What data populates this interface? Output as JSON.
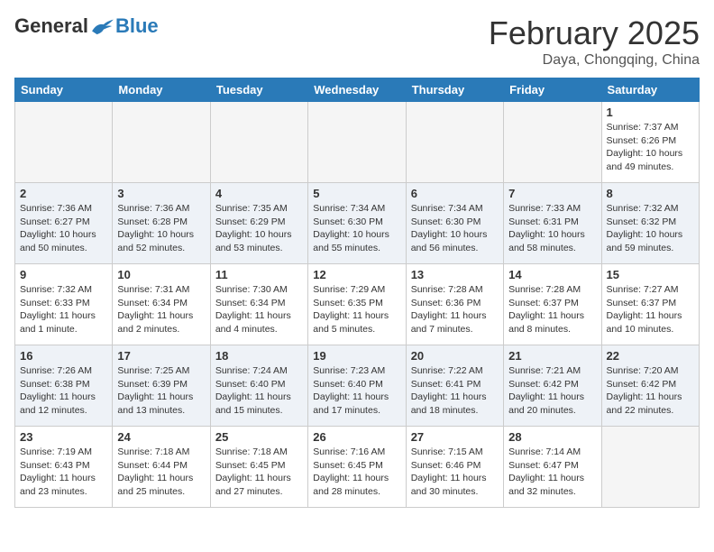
{
  "logo": {
    "general": "General",
    "blue": "Blue"
  },
  "title": "February 2025",
  "subtitle": "Daya, Chongqing, China",
  "days_of_week": [
    "Sunday",
    "Monday",
    "Tuesday",
    "Wednesday",
    "Thursday",
    "Friday",
    "Saturday"
  ],
  "weeks": [
    [
      {
        "day": "",
        "info": ""
      },
      {
        "day": "",
        "info": ""
      },
      {
        "day": "",
        "info": ""
      },
      {
        "day": "",
        "info": ""
      },
      {
        "day": "",
        "info": ""
      },
      {
        "day": "",
        "info": ""
      },
      {
        "day": "1",
        "info": "Sunrise: 7:37 AM\nSunset: 6:26 PM\nDaylight: 10 hours and 49 minutes."
      }
    ],
    [
      {
        "day": "2",
        "info": "Sunrise: 7:36 AM\nSunset: 6:27 PM\nDaylight: 10 hours and 50 minutes."
      },
      {
        "day": "3",
        "info": "Sunrise: 7:36 AM\nSunset: 6:28 PM\nDaylight: 10 hours and 52 minutes."
      },
      {
        "day": "4",
        "info": "Sunrise: 7:35 AM\nSunset: 6:29 PM\nDaylight: 10 hours and 53 minutes."
      },
      {
        "day": "5",
        "info": "Sunrise: 7:34 AM\nSunset: 6:30 PM\nDaylight: 10 hours and 55 minutes."
      },
      {
        "day": "6",
        "info": "Sunrise: 7:34 AM\nSunset: 6:30 PM\nDaylight: 10 hours and 56 minutes."
      },
      {
        "day": "7",
        "info": "Sunrise: 7:33 AM\nSunset: 6:31 PM\nDaylight: 10 hours and 58 minutes."
      },
      {
        "day": "8",
        "info": "Sunrise: 7:32 AM\nSunset: 6:32 PM\nDaylight: 10 hours and 59 minutes."
      }
    ],
    [
      {
        "day": "9",
        "info": "Sunrise: 7:32 AM\nSunset: 6:33 PM\nDaylight: 11 hours and 1 minute."
      },
      {
        "day": "10",
        "info": "Sunrise: 7:31 AM\nSunset: 6:34 PM\nDaylight: 11 hours and 2 minutes."
      },
      {
        "day": "11",
        "info": "Sunrise: 7:30 AM\nSunset: 6:34 PM\nDaylight: 11 hours and 4 minutes."
      },
      {
        "day": "12",
        "info": "Sunrise: 7:29 AM\nSunset: 6:35 PM\nDaylight: 11 hours and 5 minutes."
      },
      {
        "day": "13",
        "info": "Sunrise: 7:28 AM\nSunset: 6:36 PM\nDaylight: 11 hours and 7 minutes."
      },
      {
        "day": "14",
        "info": "Sunrise: 7:28 AM\nSunset: 6:37 PM\nDaylight: 11 hours and 8 minutes."
      },
      {
        "day": "15",
        "info": "Sunrise: 7:27 AM\nSunset: 6:37 PM\nDaylight: 11 hours and 10 minutes."
      }
    ],
    [
      {
        "day": "16",
        "info": "Sunrise: 7:26 AM\nSunset: 6:38 PM\nDaylight: 11 hours and 12 minutes."
      },
      {
        "day": "17",
        "info": "Sunrise: 7:25 AM\nSunset: 6:39 PM\nDaylight: 11 hours and 13 minutes."
      },
      {
        "day": "18",
        "info": "Sunrise: 7:24 AM\nSunset: 6:40 PM\nDaylight: 11 hours and 15 minutes."
      },
      {
        "day": "19",
        "info": "Sunrise: 7:23 AM\nSunset: 6:40 PM\nDaylight: 11 hours and 17 minutes."
      },
      {
        "day": "20",
        "info": "Sunrise: 7:22 AM\nSunset: 6:41 PM\nDaylight: 11 hours and 18 minutes."
      },
      {
        "day": "21",
        "info": "Sunrise: 7:21 AM\nSunset: 6:42 PM\nDaylight: 11 hours and 20 minutes."
      },
      {
        "day": "22",
        "info": "Sunrise: 7:20 AM\nSunset: 6:42 PM\nDaylight: 11 hours and 22 minutes."
      }
    ],
    [
      {
        "day": "23",
        "info": "Sunrise: 7:19 AM\nSunset: 6:43 PM\nDaylight: 11 hours and 23 minutes."
      },
      {
        "day": "24",
        "info": "Sunrise: 7:18 AM\nSunset: 6:44 PM\nDaylight: 11 hours and 25 minutes."
      },
      {
        "day": "25",
        "info": "Sunrise: 7:18 AM\nSunset: 6:45 PM\nDaylight: 11 hours and 27 minutes."
      },
      {
        "day": "26",
        "info": "Sunrise: 7:16 AM\nSunset: 6:45 PM\nDaylight: 11 hours and 28 minutes."
      },
      {
        "day": "27",
        "info": "Sunrise: 7:15 AM\nSunset: 6:46 PM\nDaylight: 11 hours and 30 minutes."
      },
      {
        "day": "28",
        "info": "Sunrise: 7:14 AM\nSunset: 6:47 PM\nDaylight: 11 hours and 32 minutes."
      },
      {
        "day": "",
        "info": ""
      }
    ]
  ]
}
